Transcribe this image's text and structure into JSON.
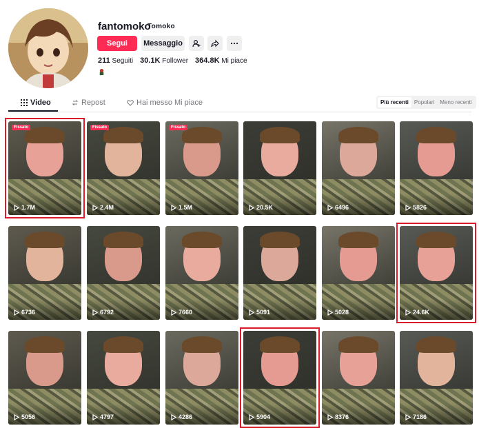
{
  "profile": {
    "username": "fantomoko",
    "nickname": "Tomoko",
    "follow_label": "Segui",
    "message_label": "Messaggio",
    "stats": [
      {
        "value": "211",
        "label": "Seguiti"
      },
      {
        "value": "30.1K",
        "label": "Follower"
      },
      {
        "value": "364.8K",
        "label": "Mi piace"
      }
    ]
  },
  "tabs": [
    {
      "label": "Video",
      "icon": "grid-icon"
    },
    {
      "label": "Repost",
      "icon": "repost-icon"
    },
    {
      "label": "Hai messo Mi piace",
      "icon": "heart-lock-icon"
    }
  ],
  "sort_options": [
    "Più recenti",
    "Popolari",
    "Meno recenti"
  ],
  "videos": [
    {
      "views": "1.7M",
      "pinned": "Fissato",
      "highlighted": true
    },
    {
      "views": "2.4M",
      "pinned": "Fissato",
      "highlighted": false
    },
    {
      "views": "1.5M",
      "pinned": "Fissato",
      "highlighted": false
    },
    {
      "views": "20.5K",
      "pinned": "",
      "highlighted": false
    },
    {
      "views": "6496",
      "pinned": "",
      "highlighted": false
    },
    {
      "views": "5826",
      "pinned": "",
      "highlighted": false
    },
    {
      "views": "6736",
      "pinned": "",
      "highlighted": false
    },
    {
      "views": "6792",
      "pinned": "",
      "highlighted": false
    },
    {
      "views": "7660",
      "pinned": "",
      "highlighted": false
    },
    {
      "views": "5091",
      "pinned": "",
      "highlighted": false
    },
    {
      "views": "5028",
      "pinned": "",
      "highlighted": false
    },
    {
      "views": "24.6K",
      "pinned": "",
      "highlighted": true
    },
    {
      "views": "5056",
      "pinned": "",
      "highlighted": false
    },
    {
      "views": "4797",
      "pinned": "",
      "highlighted": false
    },
    {
      "views": "4286",
      "pinned": "",
      "highlighted": false
    },
    {
      "views": "5904",
      "pinned": "",
      "highlighted": true
    },
    {
      "views": "8376",
      "pinned": "",
      "highlighted": false
    },
    {
      "views": "7186",
      "pinned": "",
      "highlighted": false
    }
  ],
  "colors": {
    "accent": "#fe2c55",
    "highlight": "#d91b2a"
  }
}
